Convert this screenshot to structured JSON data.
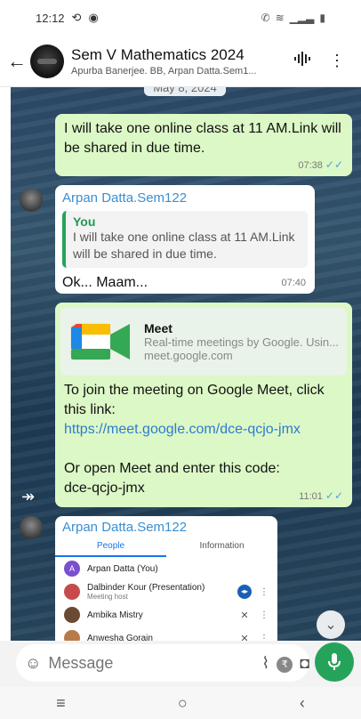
{
  "status": {
    "time": "12:12"
  },
  "header": {
    "title": "Sem V Mathematics 2024",
    "subtitle": "Apurba Banerjee. BB, Arpan Datta.Sem1..."
  },
  "chat": {
    "date_chip": "May 8, 2024",
    "msg1": {
      "text": "I will take one online class at 11 AM.Link will be shared in due time.",
      "time": "07:38"
    },
    "msg2": {
      "sender": "Arpan Datta.Sem122",
      "quote_author": "You",
      "quote_text": "I will take one online class at 11 AM.Link will be shared in due time.",
      "text": "Ok... Maam...",
      "time": "07:40"
    },
    "msg3": {
      "preview_title": "Meet",
      "preview_desc": "Real-time meetings by Google. Usin...",
      "preview_domain": "meet.google.com",
      "line1": "To join the meeting on Google Meet, click this link:",
      "link": "https://meet.google.com/dce-qcjo-jmx",
      "line2": "Or open Meet and enter this code:",
      "code": "dce-qcjo-jmx",
      "time": "11:01"
    },
    "msg4": {
      "sender": "Arpan Datta.Sem122",
      "tabs": [
        "People",
        "Information"
      ],
      "people": [
        {
          "name": "Arpan Datta (You)",
          "sub": "",
          "avatar_color": "#7b4fd0"
        },
        {
          "name": "Dalbinder Kour (Presentation)",
          "sub": "Meeting host",
          "avatar_color": "#c74b4b"
        },
        {
          "name": "Ambika Mistry",
          "sub": "",
          "avatar_color": "#6b4a33"
        },
        {
          "name": "Anwesha Gorain",
          "sub": "",
          "avatar_color": "#b77b4a"
        }
      ]
    }
  },
  "input": {
    "placeholder": "Message"
  },
  "colors": {
    "accent_green": "#25a35b",
    "outgoing": "#dcf8c6",
    "link": "#2e7bd1"
  }
}
